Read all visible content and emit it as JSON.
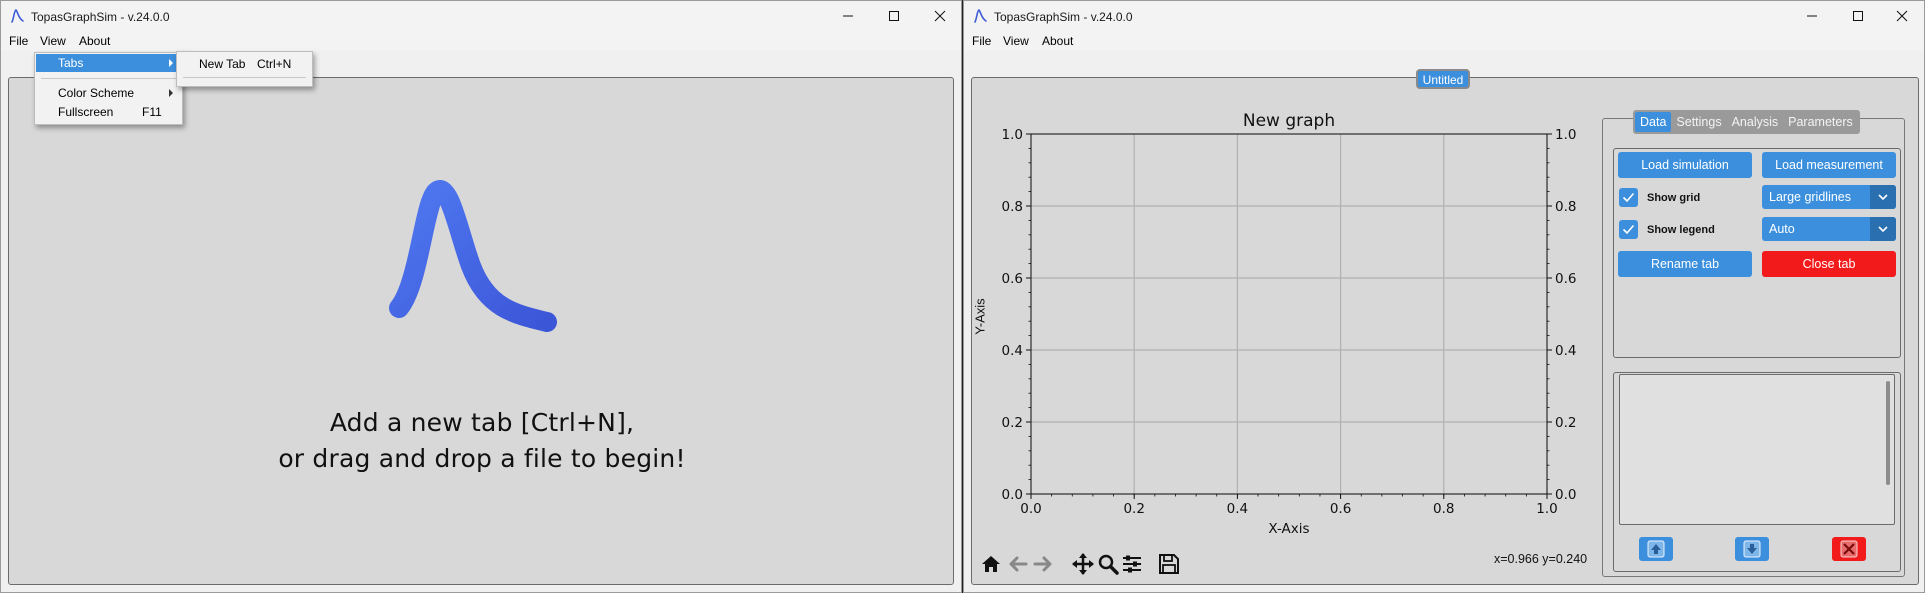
{
  "left_window": {
    "title": "TopasGraphSim - v.24.0.0",
    "menu": [
      "File",
      "View",
      "About"
    ],
    "view_menu": {
      "tabs_label": "Tabs",
      "color_scheme_label": "Color Scheme",
      "fullscreen_label": "Fullscreen",
      "fullscreen_shortcut": "F11"
    },
    "tabs_submenu": {
      "new_tab_label": "New Tab",
      "new_tab_shortcut": "Ctrl+N"
    },
    "welcome_line1": "Add a new tab [Ctrl+N],",
    "welcome_line2": "or drag and drop a file to begin!"
  },
  "right_window": {
    "title": "TopasGraphSim - v.24.0.0",
    "menu": [
      "File",
      "View",
      "About"
    ],
    "tab_name": "Untitled",
    "coords_readout": "x=0.966 y=0.240",
    "panel_tabs": [
      "Data",
      "Settings",
      "Analysis",
      "Parameters"
    ],
    "active_panel_tab": "Data",
    "buttons": {
      "load_simulation": "Load simulation",
      "load_measurement": "Load measurement",
      "rename_tab": "Rename tab",
      "close_tab": "Close tab"
    },
    "checkboxes": {
      "show_grid": {
        "label": "Show grid",
        "checked": true
      },
      "show_legend": {
        "label": "Show legend",
        "checked": true
      }
    },
    "combos": {
      "gridlines": "Large gridlines",
      "legend": "Auto"
    },
    "toolbar_icons": [
      "home-icon",
      "back-arrow-icon",
      "forward-arrow-icon",
      "pan-icon",
      "zoom-icon",
      "configure-subplots-icon",
      "save-icon"
    ],
    "list_buttons": [
      "move-up-icon",
      "move-down-icon",
      "delete-icon"
    ]
  },
  "colors": {
    "accent": "#3b8fdd",
    "danger": "#f21a1a",
    "plot_background": "#d8d8d8",
    "logo_blue": "#4a6be8"
  },
  "chart_data": {
    "type": "line",
    "title": "New graph",
    "xlabel": "X-Axis",
    "ylabel": "Y-Axis",
    "xlim": [
      0.0,
      1.0
    ],
    "ylim": [
      0.0,
      1.0
    ],
    "xticks": [
      "0.0",
      "0.2",
      "0.4",
      "0.6",
      "0.8",
      "1.0"
    ],
    "yticks": [
      "0.0",
      "0.2",
      "0.4",
      "0.6",
      "0.8",
      "1.0"
    ],
    "right_yticks": [
      "0.0",
      "0.2",
      "0.4",
      "0.6",
      "0.8",
      "1.0"
    ],
    "grid": true,
    "series": []
  }
}
